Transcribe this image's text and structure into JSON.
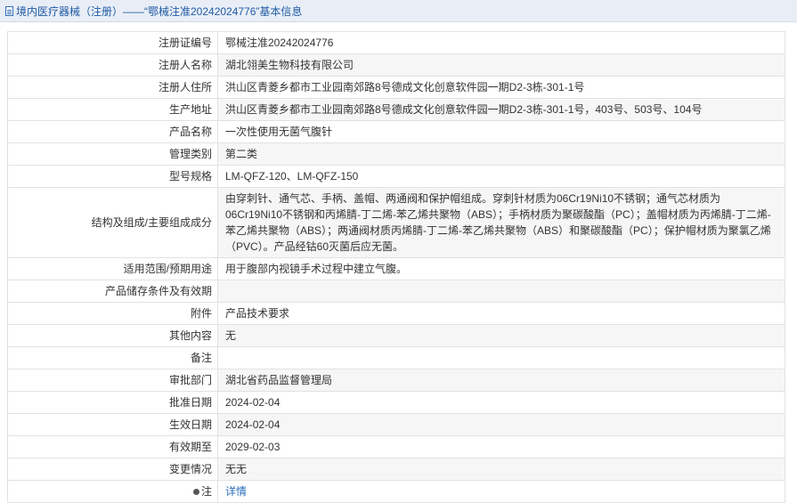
{
  "header": {
    "title": "境内医疗器械（注册）——“鄂械注准20242024776”基本信息"
  },
  "rows": [
    {
      "label": "注册证编号",
      "value": "鄂械注准20242024776"
    },
    {
      "label": "注册人名称",
      "value": "湖北翎美生物科技有限公司"
    },
    {
      "label": "注册人住所",
      "value": "洪山区青菱乡都市工业园南郊路8号德成文化创意软件园一期D2-3栋-301-1号"
    },
    {
      "label": "生产地址",
      "value": "洪山区青菱乡都市工业园南郊路8号德成文化创意软件园一期D2-3栋-301-1号，403号、503号、104号"
    },
    {
      "label": "产品名称",
      "value": "一次性使用无菌气腹针"
    },
    {
      "label": "管理类别",
      "value": "第二类"
    },
    {
      "label": "型号规格",
      "value": "LM-QFZ-120、LM-QFZ-150"
    },
    {
      "label": "结构及组成/主要组成成分",
      "value": "由穿刺针、通气芯、手柄、盖帽、两通阀和保护帽组成。穿刺针材质为06Cr19Ni10不锈钢；通气芯材质为06Cr19Ni10不锈钢和丙烯腈-丁二烯-苯乙烯共聚物（ABS）；手柄材质为聚碳酸酯（PC）；盖帽材质为丙烯腈-丁二烯-苯乙烯共聚物（ABS）；两通阀材质丙烯腈-丁二烯-苯乙烯共聚物（ABS）和聚碳酸酯（PC）；保护帽材质为聚氯乙烯（PVC）。产品经钴60灭菌后应无菌。"
    },
    {
      "label": "适用范围/预期用途",
      "value": "用于腹部内视镜手术过程中建立气腹。"
    },
    {
      "label": "产品储存条件及有效期",
      "value": ""
    },
    {
      "label": "附件",
      "value": "产品技术要求"
    },
    {
      "label": "其他内容",
      "value": "无"
    },
    {
      "label": "备注",
      "value": ""
    },
    {
      "label": "审批部门",
      "value": "湖北省药品监督管理局"
    },
    {
      "label": "批准日期",
      "value": "2024-02-04"
    },
    {
      "label": "生效日期",
      "value": "2024-02-04"
    },
    {
      "label": "有效期至",
      "value": "2029-02-03"
    },
    {
      "label": "变更情况",
      "value": "无无"
    }
  ],
  "note_row": {
    "label": "注",
    "link_text": "详情"
  },
  "icons": {
    "title": "document-icon",
    "note": "pin-icon"
  },
  "colors": {
    "accent": "#1f5aa6",
    "link": "#2a6ebb",
    "header_bg": "#e9eef6",
    "stripe": "#f6f6f6"
  }
}
